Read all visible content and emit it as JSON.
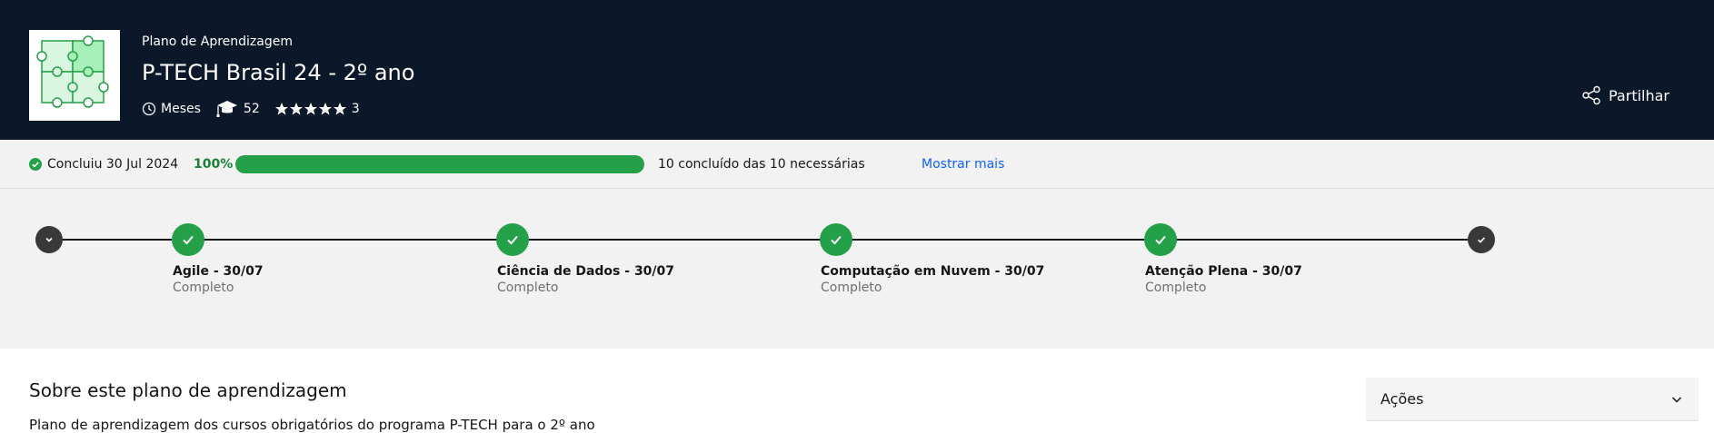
{
  "header": {
    "kicker": "Plano de Aprendizagem",
    "title": "P-TECH Brasil 24 - 2º ano",
    "duration": "Meses",
    "learners": "52",
    "rating_count": "3",
    "rating_stars": 5,
    "share_label": "Partilhar",
    "bg_color": "#0b1829"
  },
  "progress": {
    "completed_label": "Concluiu 30 Jul 2024",
    "percent_text": "100%",
    "percent": 100,
    "summary": "10 concluído das 10 necessárias",
    "more_link": "Mostrar mais",
    "accent": "#24a148"
  },
  "timeline": {
    "steps": [
      {
        "name": "Agile - 30/07",
        "status": "Completo"
      },
      {
        "name": "Ciência de Dados - 30/07",
        "status": "Completo"
      },
      {
        "name": "Computação em Nuvem - 30/07",
        "status": "Completo"
      },
      {
        "name": "Atenção Plena - 30/07",
        "status": "Completo"
      }
    ]
  },
  "about": {
    "title": "Sobre este plano de aprendizagem",
    "description": "Plano de aprendizagem dos cursos obrigatórios do programa P-TECH para o 2º ano",
    "actions_label": "Ações"
  }
}
